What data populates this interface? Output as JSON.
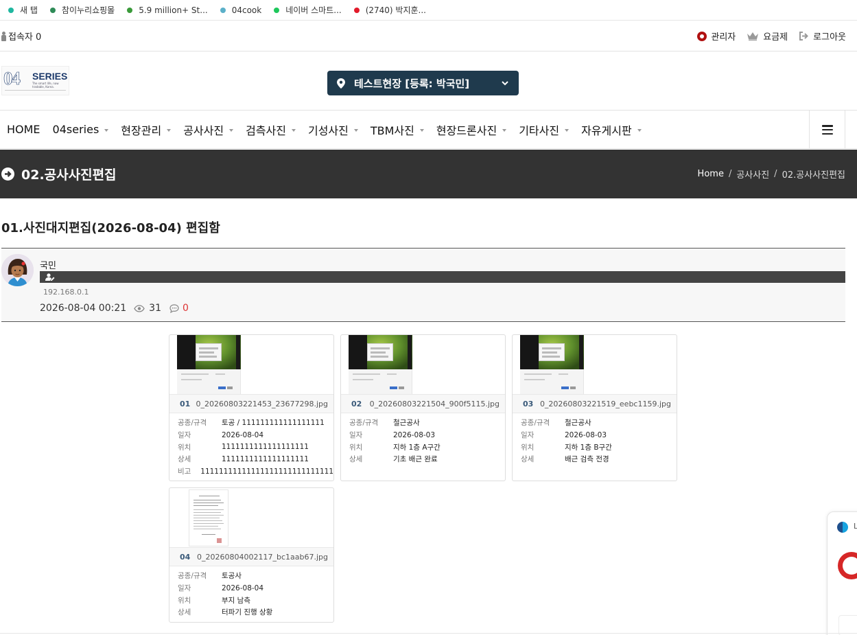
{
  "bookmarks": [
    {
      "label": "새 탭",
      "color": "#1fb7a0"
    },
    {
      "label": "참이누리쇼핑몰",
      "color": "#2e8b57"
    },
    {
      "label": "5.9 million+ St...",
      "color": "#3a9a3a"
    },
    {
      "label": "04cook",
      "color": "#5bb0c9"
    },
    {
      "label": "네이버 스마트...",
      "color": "#1ec75c"
    },
    {
      "label": "(2740) 박지훈...",
      "color": "#e21b2b"
    }
  ],
  "utilbar": {
    "visitors": "접속자 0",
    "admin": "관리자",
    "plan": "요금제",
    "logout": "로그아웃",
    "admin_icon_color": "#b01010"
  },
  "header": {
    "logo_number": "04",
    "logo_word": "SERIES",
    "logo_tagline": "The smart life, now tradable, Korea.",
    "site_selector": "테스트현장 [등록: 박국민]"
  },
  "nav": {
    "items": [
      "HOME",
      "04series",
      "현장관리",
      "공사사진",
      "검측사진",
      "기성사진",
      "TBM사진",
      "현장드론사진",
      "기타사진",
      "자유게시판"
    ]
  },
  "page_band": {
    "title": "02.공사사진편집",
    "breadcrumb": [
      "Home",
      "공사사진",
      "02.공사사진편집"
    ]
  },
  "post": {
    "title": "01.사진대지편집(2026-08-04) 편집함",
    "author": "국민",
    "ip": "192.168.0.1",
    "datetime": "2026-08-04 00:21",
    "views": "31",
    "comments": "0"
  },
  "field_labels": {
    "type": "공종/규격",
    "date": "일자",
    "location": "위치",
    "detail": "상세",
    "note": "비고"
  },
  "photos": [
    {
      "no": "01",
      "filename": "0_20260803221453_23677298.jpg",
      "type": "토공 / 111111111111111111",
      "date": "2026-08-04",
      "location": "1111111111111111111",
      "detail": "1111111111111111111",
      "note": "11111111111111111111111111111"
    },
    {
      "no": "02",
      "filename": "0_20260803221504_900f5115.jpg",
      "type": "철근공사",
      "date": "2026-08-03",
      "location": "지하 1층 A구간",
      "detail": "기초 배근 완료"
    },
    {
      "no": "03",
      "filename": "0_20260803221519_eebc1159.jpg",
      "type": "철근공사",
      "date": "2026-08-03",
      "location": "지하 1층 B구간",
      "detail": "배근 검측 전경"
    },
    {
      "no": "04",
      "filename": "0_20260804002117_bc1aab67.jpg",
      "type": "토공사",
      "date": "2026-08-04",
      "location": "부지 남측",
      "detail": "터파기 진행 상황"
    }
  ],
  "float_widget": {
    "label": "L"
  },
  "colors": {
    "site_select_bg": "#1f3a4d",
    "band_bg": "#333333",
    "comment_count": "#dd3333"
  }
}
